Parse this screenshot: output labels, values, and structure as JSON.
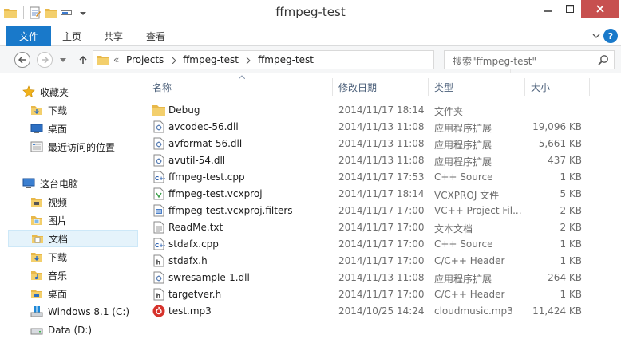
{
  "window": {
    "title": "ffmpeg-test"
  },
  "ribbon": {
    "file": "文件",
    "tabs": [
      "主页",
      "共享",
      "查看"
    ],
    "help": "?"
  },
  "address": {
    "crumbs": [
      "Projects",
      "ffmpeg-test",
      "ffmpeg-test"
    ],
    "overflow": "«"
  },
  "search": {
    "placeholder": "搜索\"ffmpeg-test\""
  },
  "navpane": {
    "items": [
      {
        "label": "收藏夹",
        "icon": "star-icon"
      },
      {
        "label": "下载",
        "icon": "download-folder-icon"
      },
      {
        "label": "桌面",
        "icon": "desktop-icon"
      },
      {
        "label": "最近访问的位置",
        "icon": "recent-places-icon"
      },
      {
        "label": "这台电脑",
        "icon": "computer-icon"
      },
      {
        "label": "视频",
        "icon": "video-folder-icon"
      },
      {
        "label": "图片",
        "icon": "picture-folder-icon"
      },
      {
        "label": "文档",
        "icon": "document-folder-icon"
      },
      {
        "label": "下载",
        "icon": "download-folder-icon"
      },
      {
        "label": "音乐",
        "icon": "music-folder-icon"
      },
      {
        "label": "桌面",
        "icon": "desktop-folder-icon"
      },
      {
        "label": "Windows 8.1 (C:)",
        "icon": "windows-drive-icon"
      },
      {
        "label": "Data (D:)",
        "icon": "drive-icon"
      }
    ]
  },
  "columns": {
    "name": "名称",
    "date": "修改日期",
    "type": "类型",
    "size": "大小"
  },
  "files": [
    {
      "name": "Debug",
      "date": "2014/11/17 18:14",
      "type": "文件夹",
      "size": "",
      "icon": "folder-icon"
    },
    {
      "name": "avcodec-56.dll",
      "date": "2014/11/13 11:08",
      "type": "应用程序扩展",
      "size": "19,096 KB",
      "icon": "dll-icon"
    },
    {
      "name": "avformat-56.dll",
      "date": "2014/11/13 11:08",
      "type": "应用程序扩展",
      "size": "5,661 KB",
      "icon": "dll-icon"
    },
    {
      "name": "avutil-54.dll",
      "date": "2014/11/13 11:08",
      "type": "应用程序扩展",
      "size": "437 KB",
      "icon": "dll-icon"
    },
    {
      "name": "ffmpeg-test.cpp",
      "date": "2014/11/17 17:53",
      "type": "C++ Source",
      "size": "1 KB",
      "icon": "cpp-file-icon"
    },
    {
      "name": "ffmpeg-test.vcxproj",
      "date": "2014/11/17 18:14",
      "type": "VCXPROJ 文件",
      "size": "5 KB",
      "icon": "vcxproj-file-icon"
    },
    {
      "name": "ffmpeg-test.vcxproj.filters",
      "date": "2014/11/17 17:00",
      "type": "VC++ Project Fil...",
      "size": "2 KB",
      "icon": "filters-file-icon"
    },
    {
      "name": "ReadMe.txt",
      "date": "2014/11/17 17:00",
      "type": "文本文档",
      "size": "2 KB",
      "icon": "text-file-icon"
    },
    {
      "name": "stdafx.cpp",
      "date": "2014/11/17 17:00",
      "type": "C++ Source",
      "size": "1 KB",
      "icon": "cpp-file-icon"
    },
    {
      "name": "stdafx.h",
      "date": "2014/11/17 17:00",
      "type": "C/C++ Header",
      "size": "1 KB",
      "icon": "header-file-icon"
    },
    {
      "name": "swresample-1.dll",
      "date": "2014/11/13 11:08",
      "type": "应用程序扩展",
      "size": "264 KB",
      "icon": "dll-icon"
    },
    {
      "name": "targetver.h",
      "date": "2014/11/17 17:00",
      "type": "C/C++ Header",
      "size": "1 KB",
      "icon": "header-file-icon"
    },
    {
      "name": "test.mp3",
      "date": "2014/10/25 14:24",
      "type": "cloudmusic.mp3",
      "size": "11,424 KB",
      "icon": "cloudmusic-icon"
    }
  ],
  "colors": {
    "accent": "#1979ca",
    "close": "#c7504f",
    "selection": "#e5f3fb",
    "folder": "#e8b84a"
  }
}
